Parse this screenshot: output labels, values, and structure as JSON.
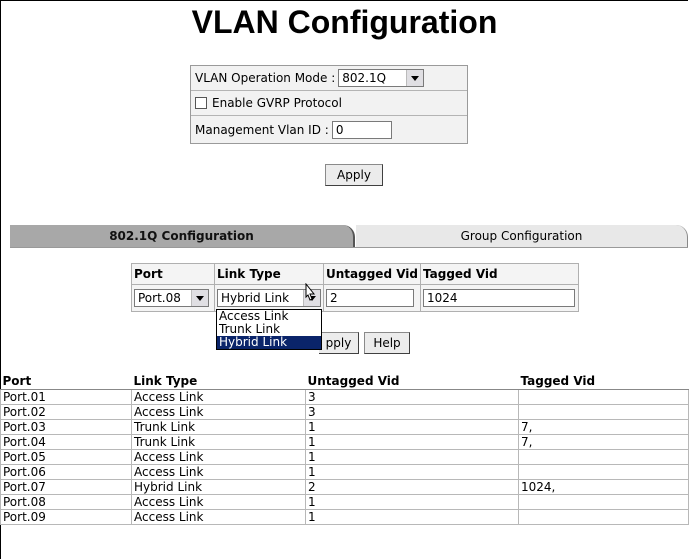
{
  "title": "VLAN Configuration",
  "options": {
    "mode_label": "VLAN Operation Mode :",
    "mode_value": "802.1Q",
    "gvrp_label": "Enable GVRP Protocol",
    "mgmt_label": "Management Vlan ID :",
    "mgmt_value": "0"
  },
  "apply_label": "Apply",
  "tabs": {
    "active": "802.1Q Configuration",
    "inactive": "Group Configuration"
  },
  "config": {
    "headers": {
      "port": "Port",
      "link_type": "Link Type",
      "untagged": "Untagged Vid",
      "tagged": "Tagged Vid"
    },
    "port_value": "Port.08",
    "link_value": "Hybrid Link",
    "untagged_value": "2",
    "tagged_value": "1024",
    "dropdown_options": [
      "Access Link",
      "Trunk Link",
      "Hybrid Link"
    ],
    "apply_label": "pply",
    "help_label": "Help"
  },
  "list": {
    "headers": {
      "port": "Port",
      "link_type": "Link Type",
      "untagged": "Untagged Vid",
      "tagged": "Tagged Vid"
    },
    "rows": [
      {
        "port": "Port.01",
        "link": "Access Link",
        "untagged": "3",
        "tagged": ""
      },
      {
        "port": "Port.02",
        "link": "Access Link",
        "untagged": "3",
        "tagged": ""
      },
      {
        "port": "Port.03",
        "link": "Trunk Link",
        "untagged": "1",
        "tagged": "7,"
      },
      {
        "port": "Port.04",
        "link": "Trunk Link",
        "untagged": "1",
        "tagged": "7,"
      },
      {
        "port": "Port.05",
        "link": "Access Link",
        "untagged": "1",
        "tagged": ""
      },
      {
        "port": "Port.06",
        "link": "Access Link",
        "untagged": "1",
        "tagged": ""
      },
      {
        "port": "Port.07",
        "link": "Hybrid Link",
        "untagged": "2",
        "tagged": "1024,"
      },
      {
        "port": "Port.08",
        "link": "Access Link",
        "untagged": "1",
        "tagged": ""
      },
      {
        "port": "Port.09",
        "link": "Access Link",
        "untagged": "1",
        "tagged": ""
      }
    ]
  }
}
